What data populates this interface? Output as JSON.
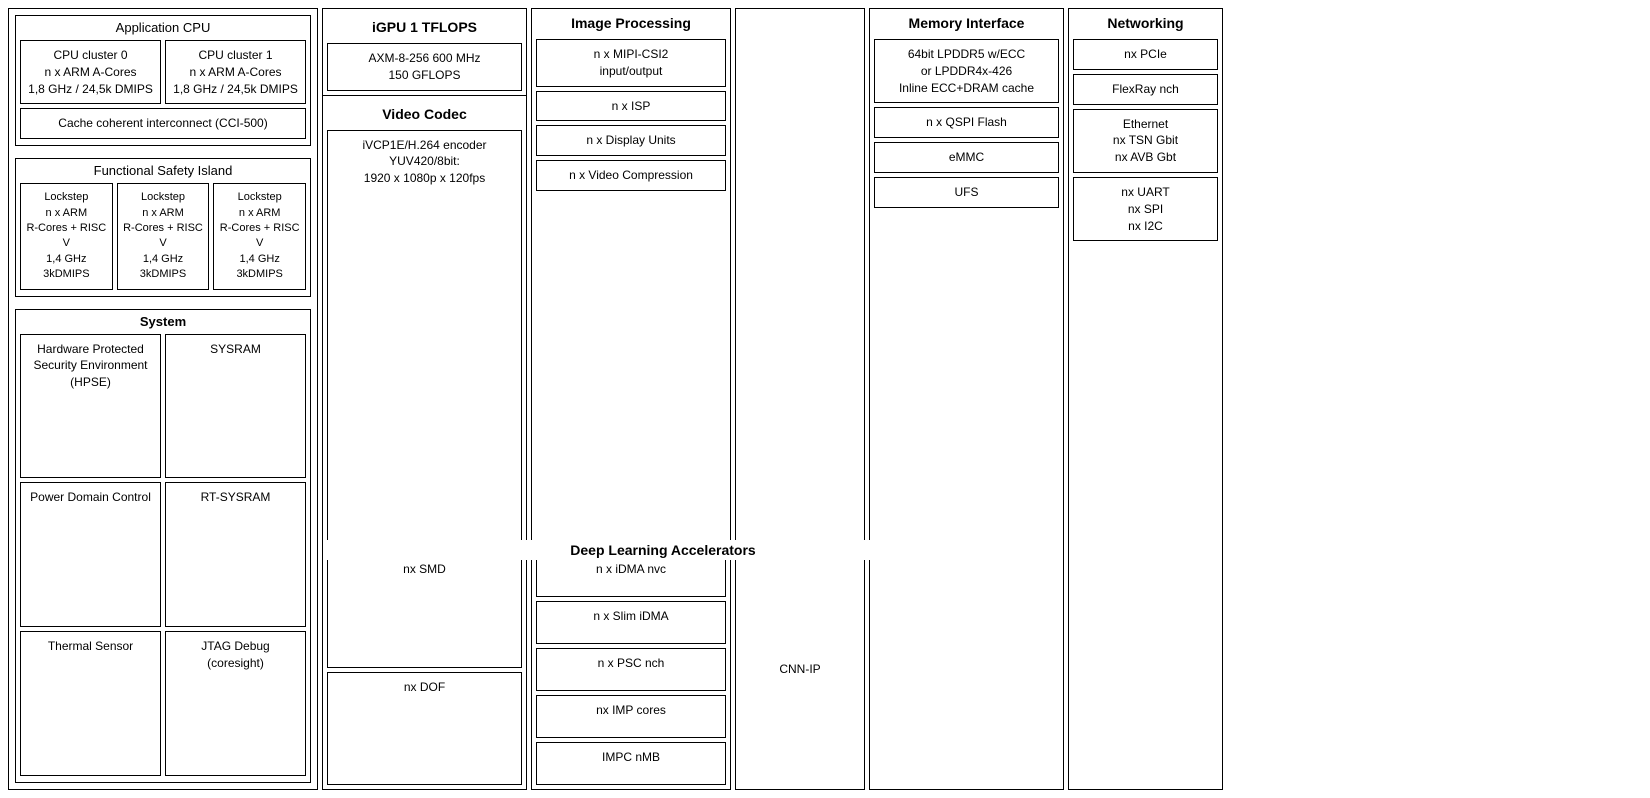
{
  "col1": {
    "sections": {
      "appCPU": {
        "title": "Application CPU",
        "cluster0": "CPU cluster 0\nn x ARM A-Cores\n1,8 GHz / 24,5k DMIPS",
        "cluster1": "CPU cluster 1\nn x ARM A-Cores\n1,8 GHz / 24,5k DMIPS",
        "cache": "Cache coherent interconnect (CCI-500)"
      },
      "funcSafety": {
        "title": "Functional Safety Island",
        "lockstep1": "Lockstep\nn x ARM\nR-Cores + RISC V\n1,4 GHz 3kDMIPS",
        "lockstep2": "Lockstep\nn x ARM\nR-Cores + RISC V\n1,4 GHz 3kDMIPS",
        "lockstep3": "Lockstep\nn x ARM\nR-Cores + RISC V\n1,4 GHz 3kDMIPS"
      },
      "system": {
        "title": "System",
        "hpse": "Hardware Protected\nSecurity Environment\n(HPSE)",
        "sysram": "SYSRAM",
        "powerDomain": "Power Domain Control",
        "rtSysram": "RT-SYSRAM",
        "thermalSensor": "Thermal Sensor",
        "jtagDebug": "JTAG Debug\n(coresight)"
      }
    }
  },
  "igpu": {
    "title": "iGPU 1 TFLOPS",
    "box": "AXM-8-256 600 MHz\n150 GFLOPS"
  },
  "videoCodec": {
    "title": "Video Codec",
    "box": "iVCP1E/H.264 encoder\nYUV420/8bit:\n1920 x 1080p x 120fps"
  },
  "imageProcessing": {
    "title": "Image Processing",
    "mipi": "n x MIPI-CSI2\ninput/output",
    "isp": "n x ISP",
    "displayUnits": "n x Display Units",
    "videoCompression": "n x Video Compression"
  },
  "deepLearning": {
    "title": "Deep Learning Accelerators",
    "smd": "nx SMD",
    "dof": "nx DOF",
    "idma": "n x iDMA nvc",
    "slimIdma": "n x Slim iDMA",
    "psc": "n x PSC nch",
    "imp": "nx IMP cores",
    "impc": "IMPC nMB",
    "cnnIp": "CNN-IP"
  },
  "memoryInterface": {
    "title": "Memory Interface",
    "lpddr": "64bit LPDDR5 w/ECC\nor LPDDR4x-426\nInline ECC+DRAM cache",
    "qspi": "n x QSPI Flash",
    "emmc": "eMMC",
    "ufs": "UFS"
  },
  "networking": {
    "title": "Networking",
    "pcie": "nx PCIe",
    "flexray": "FlexRay nch",
    "ethernet": "Ethernet\nnx TSN Gbit\nnx AVB Gbt",
    "serial": "nx UART\nnx SPI\nnx I2C"
  }
}
